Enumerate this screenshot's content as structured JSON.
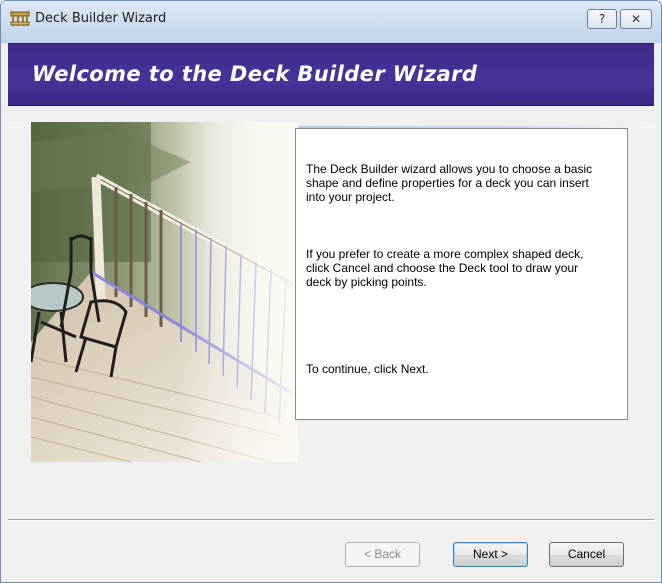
{
  "window": {
    "title": "Deck Builder Wizard",
    "help_label": "?",
    "close_label": "✕"
  },
  "banner": {
    "title": "Welcome to the Deck Builder Wizard",
    "color": "#48339b"
  },
  "content": {
    "paragraphs": [
      "The Deck Builder wizard allows you to choose a basic shape and define properties for a deck you can insert into your project.",
      "If you prefer to create a more complex shaped deck, click Cancel and choose the Deck tool to draw your deck by picking points.",
      "To continue, click Next."
    ]
  },
  "buttons": {
    "back": "< Back",
    "next": "Next >",
    "cancel": "Cancel"
  },
  "icons": {
    "app": "deck-app-icon",
    "help": "help-icon",
    "close": "close-icon"
  }
}
